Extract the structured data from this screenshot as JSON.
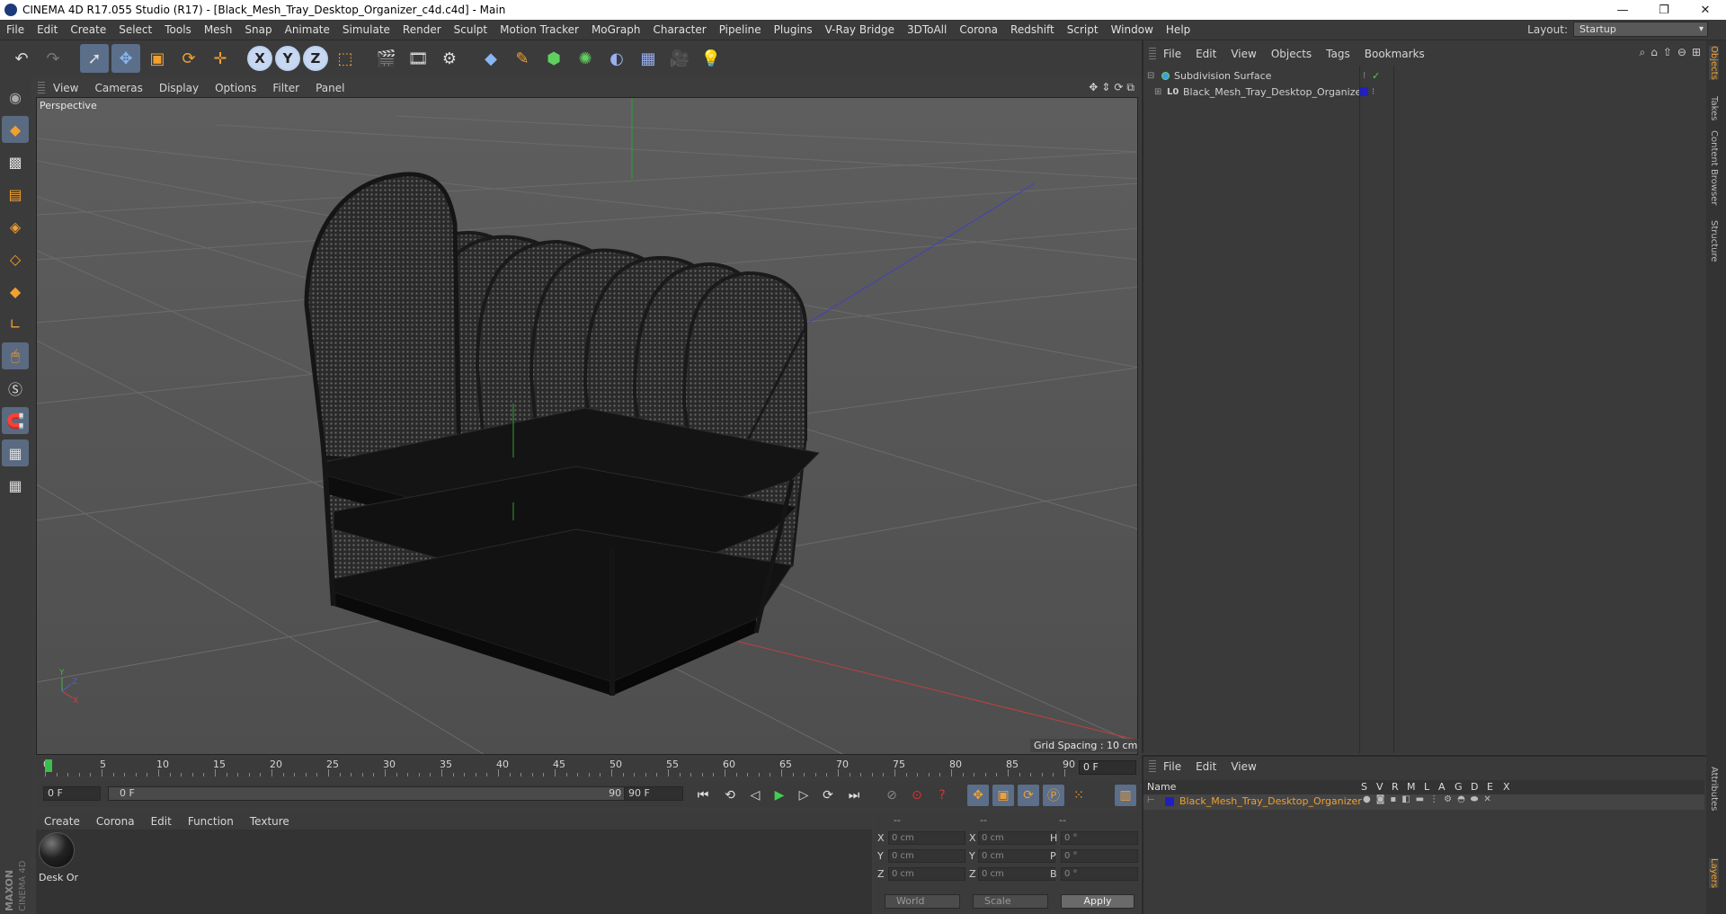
{
  "window": {
    "title": "CINEMA 4D R17.055 Studio (R17) - [Black_Mesh_Tray_Desktop_Organizer_c4d.c4d] - Main",
    "minimize": "—",
    "restore": "❐",
    "close": "✕"
  },
  "menubar": {
    "items": [
      "File",
      "Edit",
      "Create",
      "Select",
      "Tools",
      "Mesh",
      "Snap",
      "Animate",
      "Simulate",
      "Render",
      "Sculpt",
      "Motion Tracker",
      "MoGraph",
      "Character",
      "Pipeline",
      "Plugins",
      "V-Ray Bridge",
      "3DToAll",
      "Corona",
      "Redshift",
      "Script",
      "Window",
      "Help"
    ],
    "layout_label": "Layout:",
    "layout_value": "Startup"
  },
  "toolbar": {
    "icons": [
      "undo-icon",
      "redo-icon",
      "live-selection-icon",
      "move-icon",
      "scale-icon",
      "rotate-icon",
      "recent-tool-icon",
      "x-axis-icon",
      "y-axis-icon",
      "z-axis-icon",
      "coordinate-system-icon",
      "render-view-icon",
      "render-picture-viewer-icon",
      "edit-render-settings-icon",
      "cube-icon",
      "pen-spline-icon",
      "subdivision-icon",
      "cloner-icon",
      "deformer-icon",
      "floor-icon",
      "camera-icon",
      "light-icon"
    ],
    "axis_x": "X",
    "axis_y": "Y",
    "axis_z": "Z"
  },
  "viewport": {
    "menu": [
      "View",
      "Cameras",
      "Display",
      "Options",
      "Filter",
      "Panel"
    ],
    "camera_label": "Perspective",
    "grid_spacing": "Grid Spacing : 10 cm"
  },
  "timeline": {
    "ticks": [
      "0",
      "5",
      "10",
      "15",
      "20",
      "25",
      "30",
      "35",
      "40",
      "45",
      "50",
      "55",
      "60",
      "65",
      "70",
      "75",
      "80",
      "85",
      "90"
    ],
    "current_frame": "0 F",
    "start_field": "0 F",
    "range_start": "0 F",
    "range_end": "90 F",
    "end_field": "90 F"
  },
  "material_manager": {
    "menu": [
      "Create",
      "Corona",
      "Edit",
      "Function",
      "Texture"
    ],
    "material_name": "Desk Or"
  },
  "coordinates": {
    "headers": [
      "--",
      "--",
      "--"
    ],
    "rows": [
      {
        "l1": "X",
        "v1": "0 cm",
        "l2": "X",
        "v2": "0 cm",
        "l3": "H",
        "v3": "0 °"
      },
      {
        "l1": "Y",
        "v1": "0 cm",
        "l2": "Y",
        "v2": "0 cm",
        "l3": "P",
        "v3": "0 °"
      },
      {
        "l1": "Z",
        "v1": "0 cm",
        "l2": "Z",
        "v2": "0 cm",
        "l3": "B",
        "v3": "0 °"
      }
    ],
    "mode_world": "World",
    "mode_scale": "Scale",
    "apply": "Apply"
  },
  "object_manager": {
    "menu": [
      "File",
      "Edit",
      "View",
      "Objects",
      "Tags",
      "Bookmarks"
    ],
    "objects": [
      {
        "name": "Subdivision Surface",
        "color": "#3aa0e0"
      },
      {
        "name": "Black_Mesh_Tray_Desktop_Organizer",
        "color": "#2020c0"
      }
    ]
  },
  "side_tabs": [
    "Objects",
    "Takes",
    "Content Browser",
    "Structure",
    "Attributes",
    "Layers"
  ],
  "layer_manager": {
    "menu": [
      "File",
      "Edit",
      "View"
    ],
    "columns": [
      "Name",
      "S",
      "V",
      "R",
      "M",
      "L",
      "A",
      "G",
      "D",
      "E",
      "X"
    ],
    "layer_name": "Black_Mesh_Tray_Desktop_Organizer",
    "layer_color": "#2020c0"
  },
  "branding": "MAXON CINEMA 4D"
}
